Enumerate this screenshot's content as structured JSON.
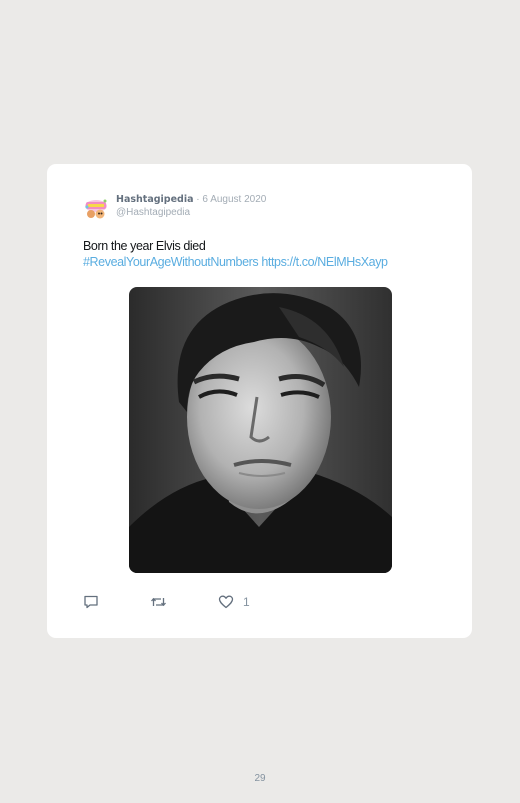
{
  "tweet": {
    "author_name": "Hashtagipedia",
    "separator": "·",
    "date": "6 August 2020",
    "handle": "@Hashtagipedia",
    "text_line1": "Born the year Elvis died",
    "hashtag": "#RevealYourAgeWithoutNumbers",
    "url": "https://t.co/NElMHsXayp",
    "like_count": "1"
  },
  "page": {
    "number": "29"
  },
  "icons": {
    "avatar": "hashtagipedia-logo",
    "reply": "reply-icon",
    "retweet": "retweet-icon",
    "like": "heart-icon"
  },
  "colors": {
    "page_background": "#ebeae8",
    "card": "#ffffff",
    "link": "#5aade0",
    "muted": "#a3acb5",
    "icon": "#8593a0"
  }
}
